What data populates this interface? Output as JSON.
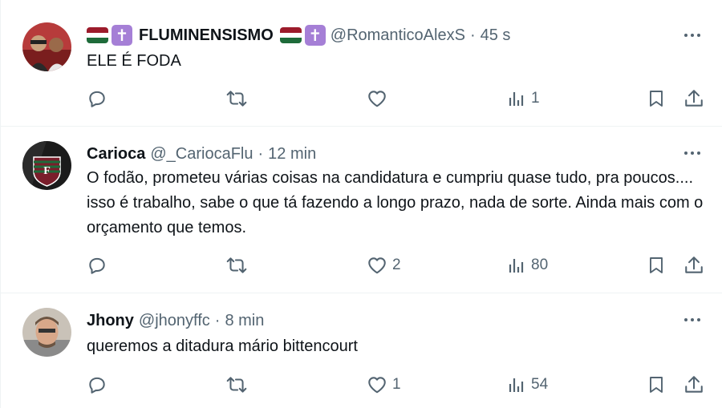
{
  "tweets": [
    {
      "name": "FLUMINENSISMO",
      "handle": "@RomanticoAlexS",
      "separator": "·",
      "time": "45 s",
      "text": "ELE É FODA",
      "replies": "",
      "retweets": "",
      "likes": "",
      "views": "1"
    },
    {
      "name": "Carioca",
      "handle": "@_CariocaFlu",
      "separator": "·",
      "time": "12 min",
      "text": "O fodão, prometeu várias coisas na candidatura e cumpriu quase tudo, pra poucos.... isso é trabalho, sabe o que tá fazendo a longo prazo, nada de sorte. Ainda mais com o orçamento que temos.",
      "replies": "",
      "retweets": "",
      "likes": "2",
      "views": "80"
    },
    {
      "name": "Jhony",
      "handle": "@jhonyffc",
      "separator": "·",
      "time": "8 min",
      "text": "queremos a ditadura mário bittencourt",
      "replies": "",
      "retweets": "",
      "likes": "1",
      "views": "54"
    }
  ],
  "emoji": {
    "cross": "✝"
  },
  "colors": {
    "text": "#0f1419",
    "secondary": "#536471",
    "divider": "#eff3f4",
    "flag_red": "#9c1b2b",
    "flag_white": "#ffffff",
    "flag_green": "#1e6b3a",
    "cross_bg": "#a57fd6"
  }
}
